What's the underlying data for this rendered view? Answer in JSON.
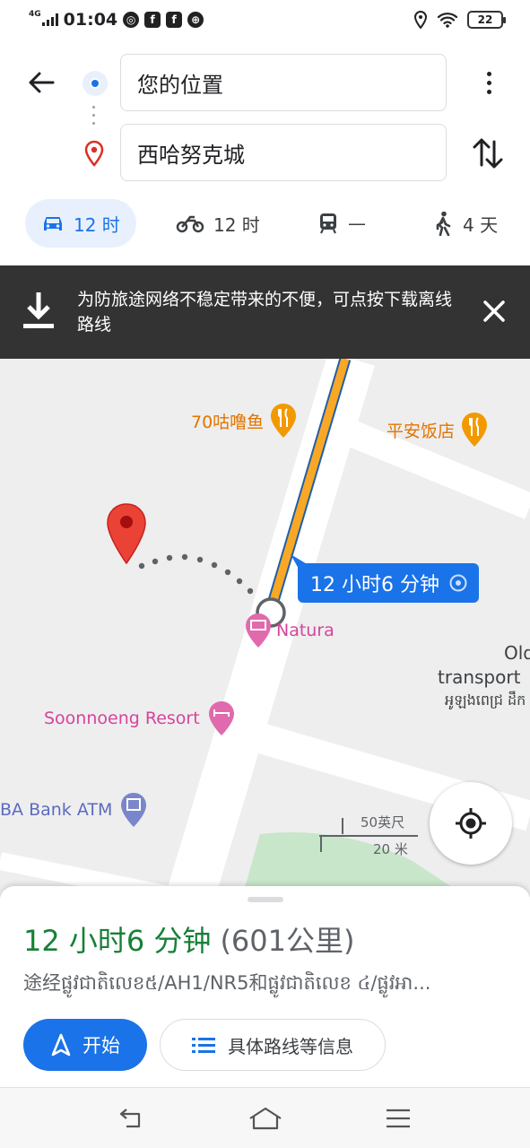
{
  "status_bar": {
    "network": "4G",
    "time": "01:04",
    "battery": "22",
    "icons": [
      "signal-icon",
      "wechat-icon",
      "facebook-icon",
      "facebook-icon",
      "basketball-icon",
      "location-icon",
      "wifi-icon",
      "battery-icon"
    ]
  },
  "search": {
    "origin": "您的位置",
    "destination": "西哈努克城"
  },
  "modes": [
    {
      "name": "drive",
      "label": "12 时"
    },
    {
      "name": "motorcycle",
      "label": "12 时"
    },
    {
      "name": "transit",
      "label": "—"
    },
    {
      "name": "walk",
      "label": "4 天"
    }
  ],
  "banner": {
    "text": "为防旅途网络不稳定带来的不便，可点按下载离线路线"
  },
  "map": {
    "pois": {
      "restaurant_1": "70咕噜鱼",
      "restaurant_2": "平安饭店",
      "hotel_1": "Natura",
      "hotel_2": "Soonnoeng Resort",
      "atm": "BA Bank ATM",
      "transport_line1": "Old",
      "transport_line2": "transport",
      "transport_khmer": "អូឡងពេជ្រ ដឹក"
    },
    "route_label": "12 小时6 分钟",
    "scale": {
      "imperial": "50英尺",
      "metric": "20 米"
    },
    "colors": {
      "route": "#f9a825",
      "route_label_bg": "#1a73e8"
    }
  },
  "summary": {
    "duration": "12 小时6 分钟",
    "distance": "(601公里)",
    "via": "途经ផ្លូវជាតិលេខ៥/AH1/NR5和ផ្លូវជាតិលេខ ៤/ផ្លូវអា..."
  },
  "actions": {
    "start": "开始",
    "steps": "具体路线等信息"
  },
  "colors": {
    "accent": "#1a73e8",
    "duration_green": "#188038",
    "banner_bg": "#333333"
  }
}
